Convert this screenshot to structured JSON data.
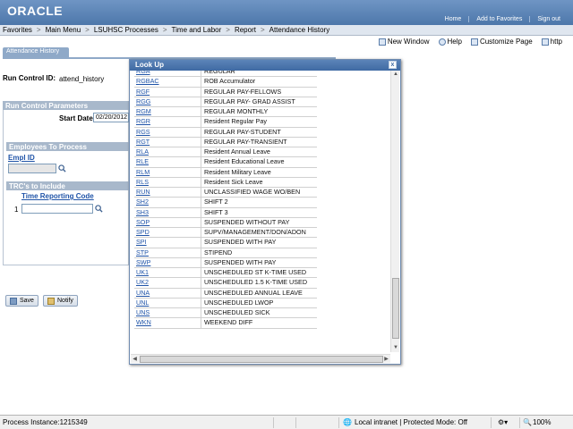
{
  "header": {
    "logo": "ORACLE",
    "links": [
      "Home",
      "Add to Favorites",
      "Sign out"
    ]
  },
  "nav": {
    "items": [
      "Favorites",
      "Main Menu",
      "LSUHSC Processes",
      "Time and Labor",
      "Report",
      "Attendance History"
    ],
    "separator": ">"
  },
  "tools": {
    "new_window": "New Window",
    "help": "Help",
    "customize": "Customize Page",
    "http": "http"
  },
  "page": {
    "tab": "Attendance History",
    "run_control_label": "Run Control ID:",
    "run_control_value": "attend_history",
    "params_header": "Run Control Parameters",
    "start_date_label": "Start Date:",
    "start_date_value": "02/20/2012",
    "employees_header": "Employees To Process",
    "empl_id_label": "Empl ID",
    "trc_header": "TRC's to Include",
    "trc_col_label": "Time Reporting Code",
    "trc_row_num": "1"
  },
  "buttons": {
    "save": "Save",
    "notify": "Notify"
  },
  "lookup": {
    "title": "Look Up",
    "close": "x",
    "rows": [
      {
        "code": "RGA",
        "desc": "REGULAR"
      },
      {
        "code": "RGBAC",
        "desc": "ROB Accumulator"
      },
      {
        "code": "RGF",
        "desc": "REGULAR PAY-FELLOWS"
      },
      {
        "code": "RGG",
        "desc": "REGULAR PAY- GRAD ASSIST"
      },
      {
        "code": "RGM",
        "desc": "REGULAR MONTHLY"
      },
      {
        "code": "RGR",
        "desc": "Resident Regular Pay"
      },
      {
        "code": "RGS",
        "desc": "REGULAR PAY-STUDENT"
      },
      {
        "code": "RGT",
        "desc": "REGULAR PAY-TRANSIENT"
      },
      {
        "code": "RLA",
        "desc": "Resident Annual Leave"
      },
      {
        "code": "RLE",
        "desc": "Resident Educational Leave"
      },
      {
        "code": "RLM",
        "desc": "Resident Military Leave"
      },
      {
        "code": "RLS",
        "desc": "Resident Sick Leave"
      },
      {
        "code": "RUN",
        "desc": "UNCLASSIFIED WAGE WO/BEN"
      },
      {
        "code": "SH2",
        "desc": "SHIFT 2"
      },
      {
        "code": "SH3",
        "desc": "SHIFT 3"
      },
      {
        "code": "SOP",
        "desc": "SUSPENDED WITHOUT PAY"
      },
      {
        "code": "SPD",
        "desc": "SUPV/MANAGEMENT/DON/ADON"
      },
      {
        "code": "SPI",
        "desc": "SUSPENDED WITH PAY"
      },
      {
        "code": "STP",
        "desc": "STIPEND"
      },
      {
        "code": "SWP",
        "desc": "SUSPENDED WITH PAY"
      },
      {
        "code": "UK1",
        "desc": "UNSCHEDULED ST K-TIME USED"
      },
      {
        "code": "UK2",
        "desc": "UNSCHEDULED 1.5 K-TIME USED"
      },
      {
        "code": "UNA",
        "desc": "UNSCHEDULED ANNUAL LEAVE"
      },
      {
        "code": "UNL",
        "desc": "UNSCHEDULED LWOP"
      },
      {
        "code": "UNS",
        "desc": "UNSCHEDULED SICK"
      },
      {
        "code": "WKN",
        "desc": "WEEKEND DIFF"
      }
    ]
  },
  "status": {
    "left": "Process Instance:1215349",
    "zone": "Local intranet | Protected Mode: Off",
    "zoom": "100%"
  },
  "colors": {
    "header": "#4d77aa",
    "link": "#2054a8",
    "modal_title": "#3f6aa3"
  }
}
